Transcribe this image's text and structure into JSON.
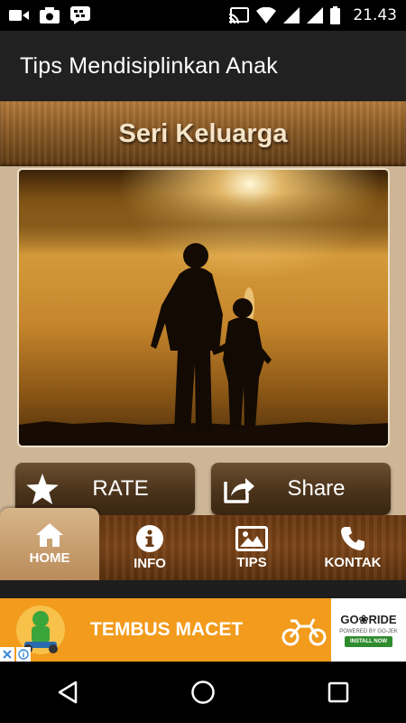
{
  "status_bar": {
    "time": "21.43",
    "left_icons": [
      "video-icon",
      "camera-icon",
      "bbm-icon"
    ],
    "right_icons": [
      "cast-icon",
      "wifi-icon",
      "signal-icon",
      "signal-icon",
      "battery-icon"
    ]
  },
  "app_bar": {
    "title": "Tips Mendisiplinkan Anak"
  },
  "banner": {
    "title": "Seri Keluarga"
  },
  "hero_image": {
    "alt": "photo",
    "subject": "silhouette of adult and child at sunset over misty sea"
  },
  "actions": {
    "rate": {
      "label": "RATE",
      "icon": "star-icon"
    },
    "share": {
      "label": "Share",
      "icon": "share-icon"
    }
  },
  "bottom_nav": {
    "items": [
      {
        "label": "HOME",
        "icon": "home-icon",
        "active": true
      },
      {
        "label": "INFO",
        "icon": "info-icon",
        "active": false
      },
      {
        "label": "TIPS",
        "icon": "image-icon",
        "active": false
      },
      {
        "label": "KONTAK",
        "icon": "phone-icon",
        "active": false
      }
    ]
  },
  "ad": {
    "headline": "TEMBUS MACET",
    "brand": "GO❀RIDE",
    "brand_sub": "POWERED BY GO-JEK",
    "cta": "INSTALL NOW",
    "background": "#f29b1c"
  },
  "colors": {
    "app_bar": "#212121",
    "wood": "#7c4518",
    "content_bg": "#cdb595",
    "active_tab": "#c9a071"
  }
}
